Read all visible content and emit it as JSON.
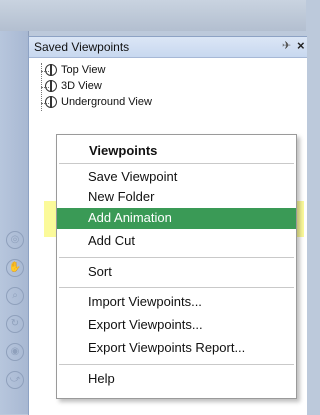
{
  "panel": {
    "title": "Saved Viewpoints",
    "pin_icon": "pin-icon",
    "close_icon": "close-icon",
    "pin_glyph": "✈",
    "close_glyph": "×"
  },
  "tree": {
    "items": [
      {
        "label": "Top View",
        "icon": "viewpoint-icon"
      },
      {
        "label": "3D View",
        "icon": "viewpoint-icon"
      },
      {
        "label": "Underground View",
        "icon": "viewpoint-icon"
      }
    ]
  },
  "menu": {
    "title": "Viewpoints",
    "items": [
      {
        "label": "Save Viewpoint"
      },
      {
        "label": "New Folder"
      },
      {
        "label": "Add Animation",
        "highlighted": true
      },
      {
        "label": "Add Cut"
      },
      {
        "label": "Sort"
      },
      {
        "label": "Import Viewpoints..."
      },
      {
        "label": "Export Viewpoints..."
      },
      {
        "label": "Export Viewpoints Report..."
      },
      {
        "label": "Help"
      }
    ]
  },
  "colors": {
    "selection": "#3a9a56",
    "annotation_highlight": "#f8f67a",
    "panel_header": "#c8d8ef"
  }
}
